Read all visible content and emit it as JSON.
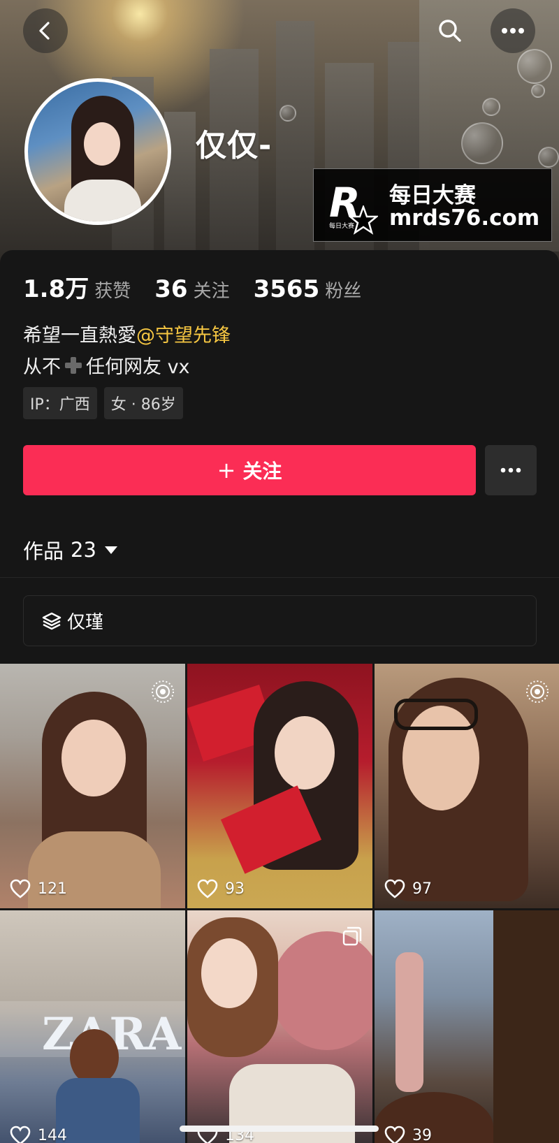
{
  "header": {
    "username": "仅仅-",
    "watermark": {
      "logo_letter": "R",
      "logo_small": "每日大赛",
      "title": "每日大赛",
      "url": "mrds76.com"
    }
  },
  "stats": [
    {
      "value": "1.8万",
      "label": "获赞"
    },
    {
      "value": "36",
      "label": "关注"
    },
    {
      "value": "3565",
      "label": "粉丝"
    }
  ],
  "bio": {
    "line1_text": "希望一直熱愛",
    "line1_mention": "@守望先锋",
    "line2_before": "从不",
    "line2_after": "任何网友 vx"
  },
  "tags": [
    "IP：广西",
    "女 · 86岁"
  ],
  "actions": {
    "follow_label": "关注"
  },
  "works": {
    "label": "作品",
    "count": "23"
  },
  "collection": {
    "label": "仅瑾"
  },
  "posts": [
    {
      "likes": "121",
      "badge": "live-icon"
    },
    {
      "likes": "93",
      "badge": ""
    },
    {
      "likes": "97",
      "badge": "live-icon"
    },
    {
      "likes": "144",
      "badge": ""
    },
    {
      "likes": "134",
      "badge": "multi-image-icon"
    },
    {
      "likes": "39",
      "badge": ""
    }
  ],
  "colors": {
    "accent": "#fb2d55",
    "mention": "#f5c642",
    "background": "#161616"
  }
}
